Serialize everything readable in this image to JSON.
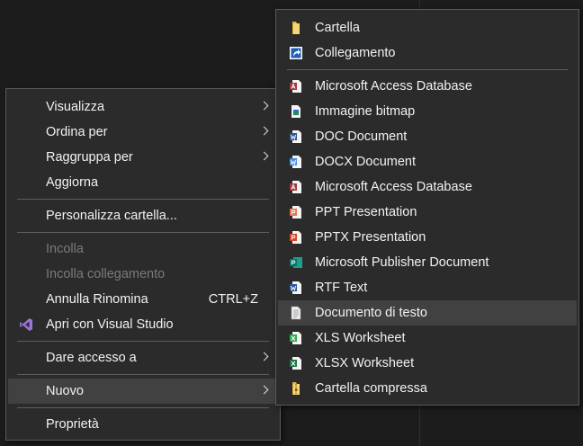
{
  "context_menu": {
    "items": [
      {
        "label": "Visualizza"
      },
      {
        "label": "Ordina per"
      },
      {
        "label": "Raggruppa per"
      },
      {
        "label": "Aggiorna"
      },
      {
        "label": "Personalizza cartella..."
      },
      {
        "label": "Incolla"
      },
      {
        "label": "Incolla collegamento"
      },
      {
        "label": "Annulla Rinomina",
        "shortcut": "CTRL+Z"
      },
      {
        "label": "Apri con Visual Studio",
        "icon": "visual-studio-icon"
      },
      {
        "label": "Dare accesso a"
      },
      {
        "label": "Nuovo"
      },
      {
        "label": "Proprietà"
      }
    ]
  },
  "submenu": {
    "items": [
      {
        "label": "Cartella",
        "icon": "folder-icon"
      },
      {
        "label": "Collegamento",
        "icon": "shortcut-icon"
      },
      {
        "label": "Microsoft Access Database",
        "icon": "access-icon"
      },
      {
        "label": "Immagine bitmap",
        "icon": "bitmap-icon"
      },
      {
        "label": "DOC Document",
        "icon": "word-doc-icon"
      },
      {
        "label": "DOCX Document",
        "icon": "word-docx-icon"
      },
      {
        "label": "Microsoft Access Database",
        "icon": "access-icon"
      },
      {
        "label": "PPT Presentation",
        "icon": "powerpoint-icon"
      },
      {
        "label": "PPTX Presentation",
        "icon": "powerpoint-icon"
      },
      {
        "label": "Microsoft Publisher Document",
        "icon": "publisher-icon"
      },
      {
        "label": "RTF Text",
        "icon": "rtf-icon"
      },
      {
        "label": "Documento di testo",
        "icon": "text-file-icon"
      },
      {
        "label": "XLS Worksheet",
        "icon": "excel-icon"
      },
      {
        "label": "XLSX Worksheet",
        "icon": "excel-icon"
      },
      {
        "label": "Cartella compressa",
        "icon": "zip-folder-icon"
      }
    ]
  },
  "colors": {
    "menu_bg": "#2b2b2b",
    "highlight": "#414141",
    "disabled_text": "#7a7a7a",
    "desktop_bg": "#1c1c1c"
  }
}
